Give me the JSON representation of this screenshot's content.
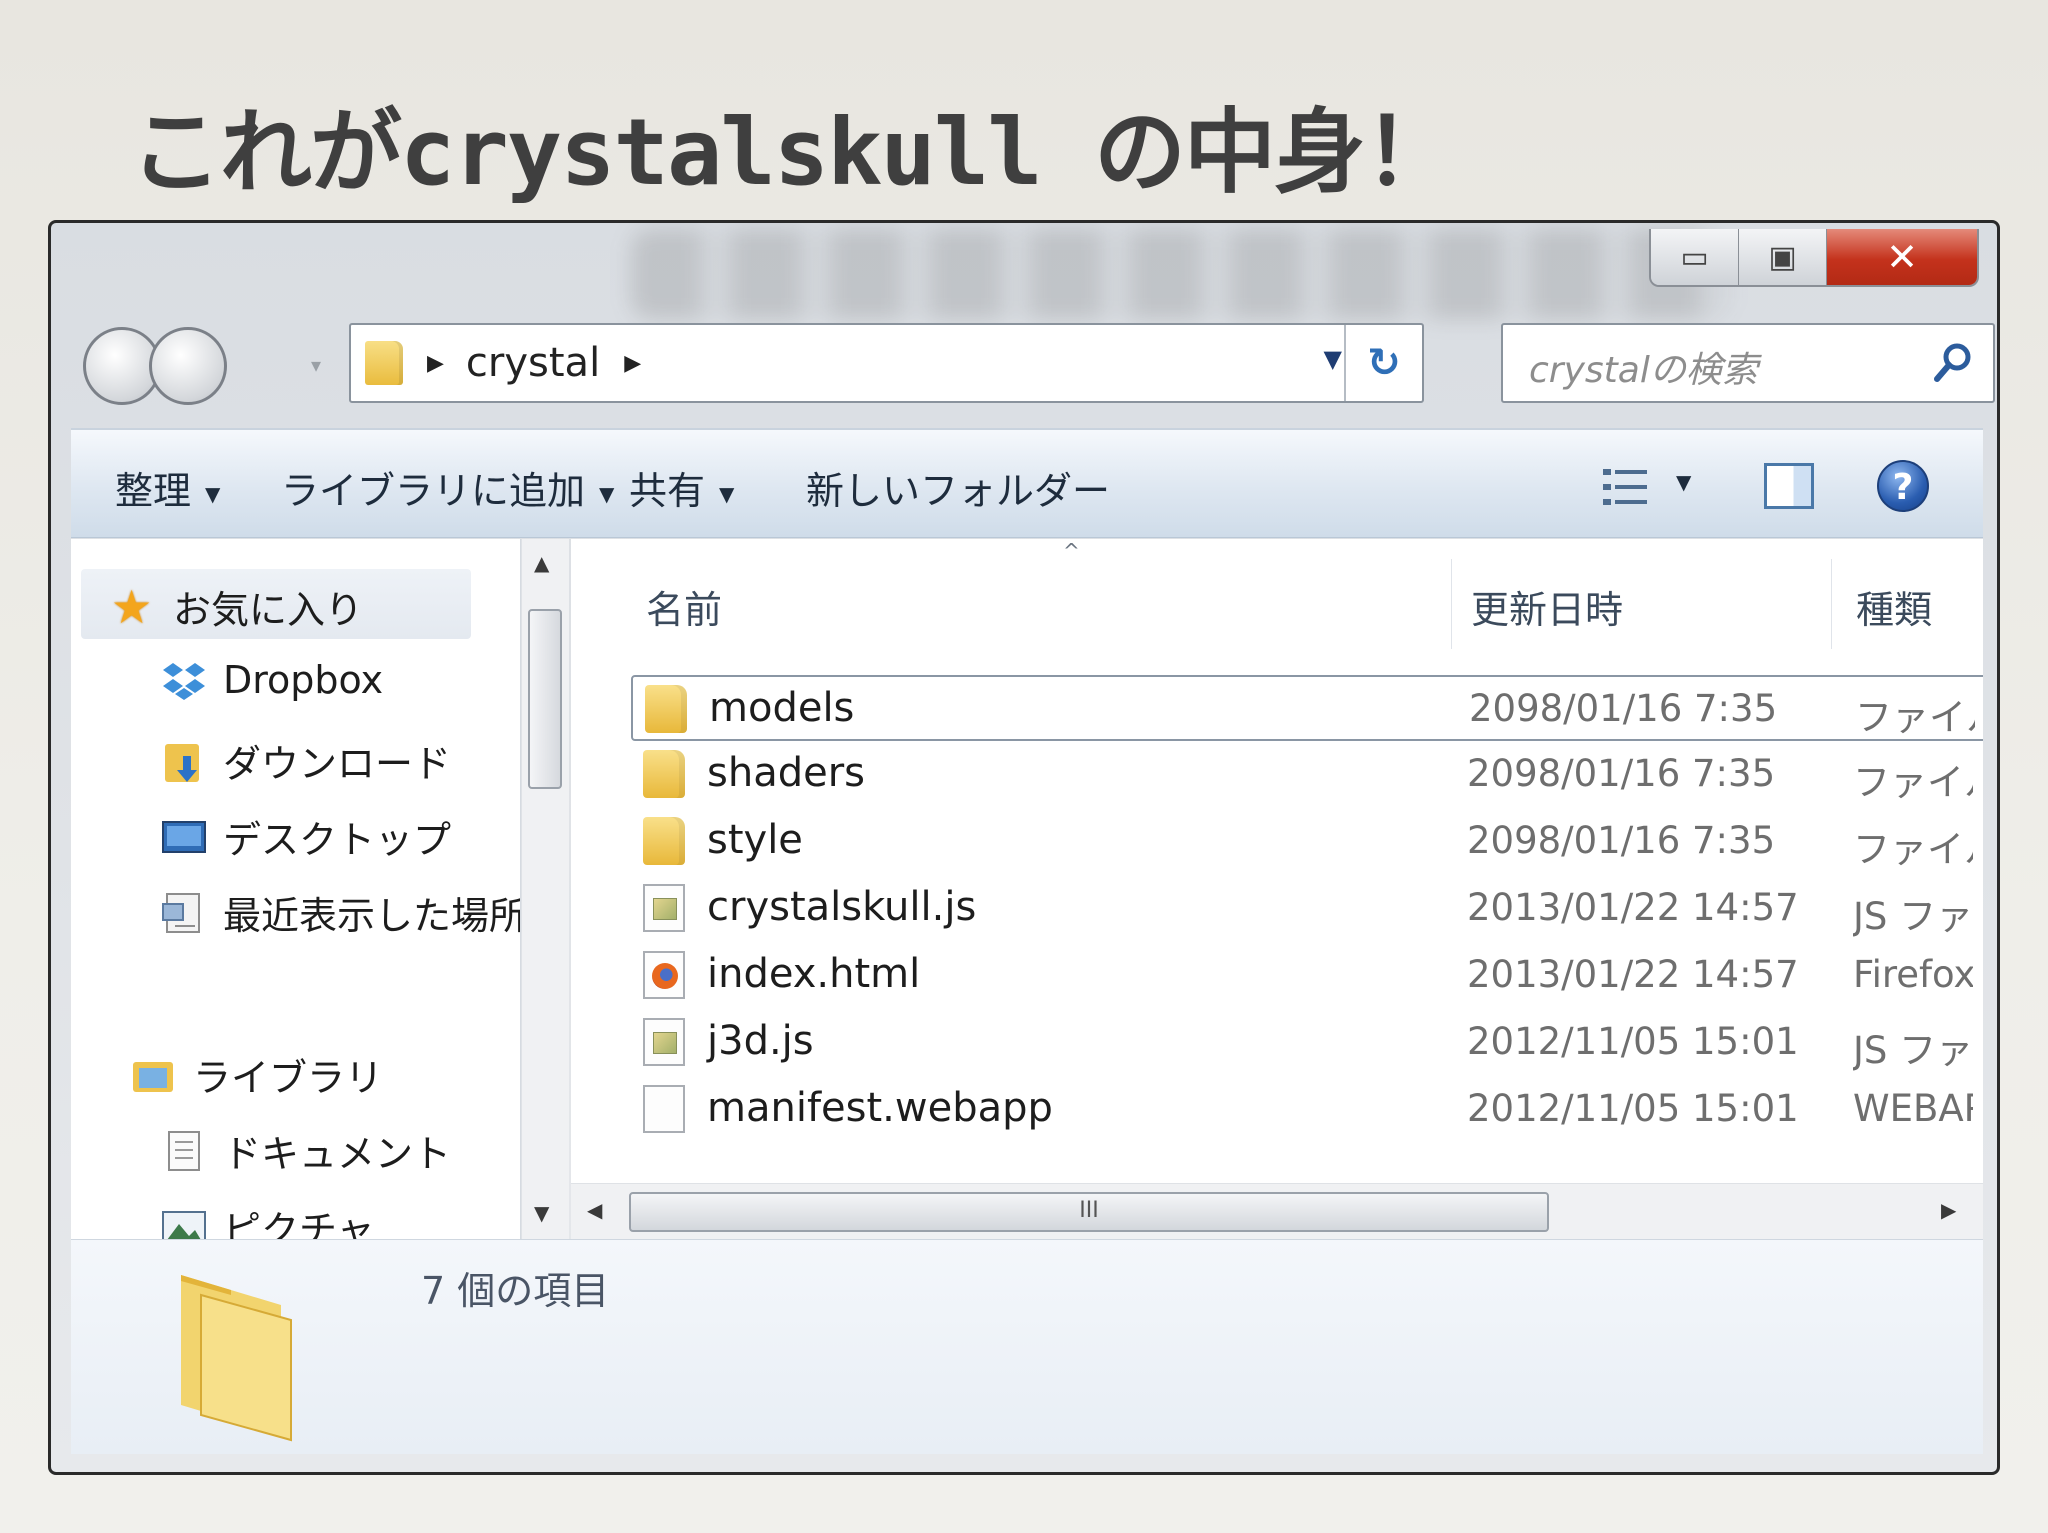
{
  "slide": {
    "title": "これがcrystalskull の中身！"
  },
  "window": {
    "caption": {
      "minimize": "▭",
      "maximize": "▣",
      "close": "✕"
    },
    "address": {
      "path": "crystal",
      "refresh_glyph": "↻"
    },
    "search": {
      "placeholder": "crystalの検索"
    },
    "toolbar": {
      "organize": "整理",
      "add_to_library": "ライブラリに追加",
      "share": "共有",
      "new_folder": "新しいフォルダー",
      "help": "?"
    },
    "nav": {
      "favorites": "お気に入り",
      "items": [
        "Dropbox",
        "ダウンロード",
        "デスクトップ",
        "最近表示した場所"
      ],
      "libraries": "ライブラリ",
      "library_items": [
        "ドキュメント",
        "ピクチャ"
      ]
    },
    "columns": {
      "name": "名前",
      "modified": "更新日時",
      "type": "種類"
    },
    "files": [
      {
        "name": "models",
        "date": "2098/01/16 7:35",
        "type": "ファイル",
        "icon": "folder-icon"
      },
      {
        "name": "shaders",
        "date": "2098/01/16 7:35",
        "type": "ファイル",
        "icon": "folder-icon"
      },
      {
        "name": "style",
        "date": "2098/01/16 7:35",
        "type": "ファイル",
        "icon": "folder-icon"
      },
      {
        "name": "crystalskull.js",
        "date": "2013/01/22 14:57",
        "type": "JS ファ",
        "icon": "js-file-icon"
      },
      {
        "name": "index.html",
        "date": "2013/01/22 14:57",
        "type": "Firefox",
        "icon": "firefox-html-icon"
      },
      {
        "name": "j3d.js",
        "date": "2012/11/05 15:01",
        "type": "JS ファ",
        "icon": "js-file-icon"
      },
      {
        "name": "manifest.webapp",
        "date": "2012/11/05 15:01",
        "type": "WEBAP",
        "icon": "blank-file-icon"
      }
    ],
    "status": {
      "item_count": "7 個の項目"
    },
    "hscroll": {
      "grip": "III"
    }
  }
}
